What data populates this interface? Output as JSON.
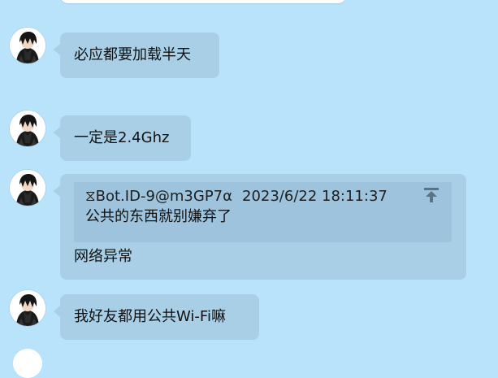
{
  "theme": {
    "background": "#b9e2fb",
    "bubble": "#a8cfe6",
    "quote_bg": "#9ec4dd",
    "text": "#111111"
  },
  "messages": [
    {
      "avatar_icon": "anime-avatar-icon",
      "text": "必应都要加载半天"
    },
    {
      "avatar_icon": "anime-avatar-icon",
      "text": "一定是2.4Ghz"
    },
    {
      "avatar_icon": "anime-avatar-icon",
      "quote": {
        "sender": "⧖Bot.ID-9@m3GP7α",
        "time": "2023/6/22 18:11:37",
        "text": "公共的东西就别嫌弃了",
        "jump_icon": "jump-to-original-icon"
      },
      "text": "网络异常"
    },
    {
      "avatar_icon": "anime-avatar-icon",
      "text": "我好友都用公共Wi-Fi嘛"
    }
  ]
}
